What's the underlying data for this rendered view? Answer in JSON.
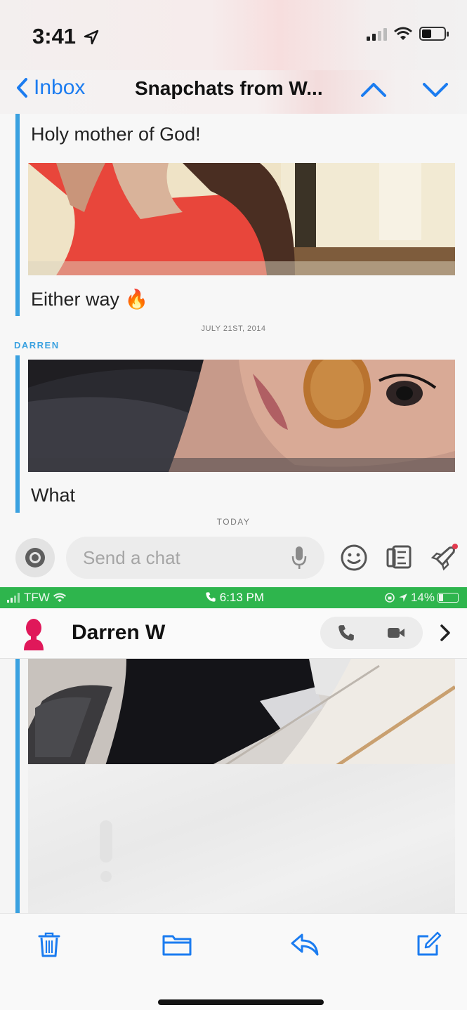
{
  "status_bar": {
    "time": "3:41"
  },
  "mail_nav": {
    "back_label": "Inbox",
    "title": "Snapchats from W..."
  },
  "conversation": {
    "message_1": "Holy mother of God!",
    "message_2": "Either way 🔥",
    "date_1": "JULY 21ST, 2014",
    "sender": "DARREN",
    "message_3": "What",
    "date_2": "TODAY"
  },
  "chat_bar": {
    "placeholder": "Send a chat"
  },
  "call_bar": {
    "carrier": "TFW",
    "call_time": "6:13 PM",
    "battery": "14%"
  },
  "chat_header": {
    "contact_name": "Darren W"
  },
  "toolbar": {
    "icons": [
      "trash-icon",
      "folder-icon",
      "reply-icon",
      "compose-icon"
    ]
  },
  "colors": {
    "accent": "#3aa1e0",
    "ios_blue": "#1b7cf0",
    "call_green": "#2eb54d",
    "avatar": "#e0185a"
  }
}
